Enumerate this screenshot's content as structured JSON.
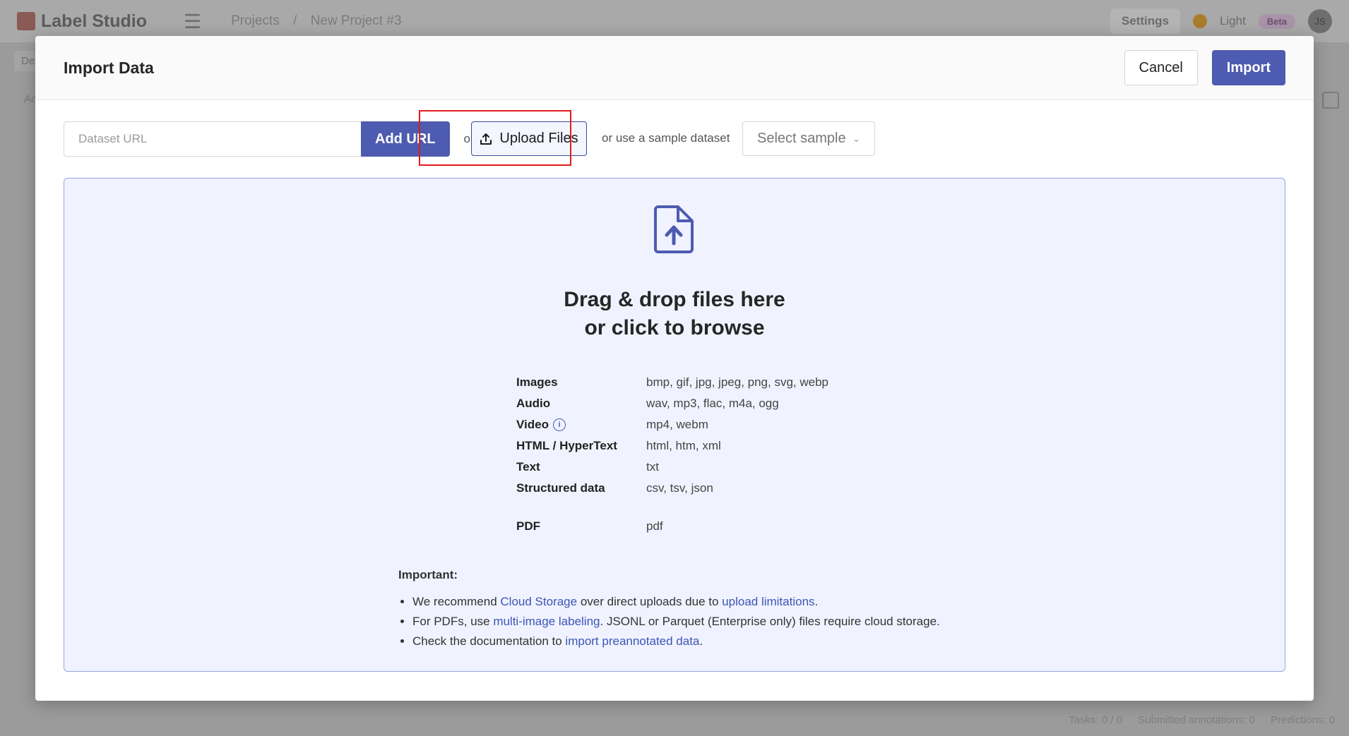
{
  "app": {
    "name": "Label Studio",
    "breadcrumbs": [
      "Projects",
      "/",
      "New Project #3"
    ],
    "settings_label": "Settings",
    "theme_label": "Light",
    "beta_label": "Beta",
    "avatar_initials": "JS",
    "bg_tab_label": "Def",
    "bg_left_text": "Ac"
  },
  "footer": {
    "tasks": "Tasks: 0 / 0",
    "submitted": "Submitted annotations: 0",
    "predictions": "Predictions: 0"
  },
  "modal": {
    "title": "Import Data",
    "cancel_label": "Cancel",
    "import_label": "Import"
  },
  "toolbar": {
    "url_placeholder": "Dataset URL",
    "add_url_label": "Add URL",
    "or_label": "or",
    "upload_label": "Upload Files",
    "sample_text": "or use a sample dataset",
    "select_sample_label": "Select sample"
  },
  "dropzone": {
    "title_line1": "Drag & drop files here",
    "title_line2": "or click to browse",
    "types": [
      {
        "name": "Images",
        "ext": "bmp, gif, jpg, jpeg, png, svg, webp"
      },
      {
        "name": "Audio",
        "ext": "wav, mp3, flac, m4a, ogg"
      },
      {
        "name": "Video",
        "ext": "mp4, webm"
      },
      {
        "name": "HTML / HyperText",
        "ext": "html, htm, xml"
      },
      {
        "name": "Text",
        "ext": "txt"
      },
      {
        "name": "Structured data",
        "ext": "csv, tsv, json"
      },
      {
        "name": "PDF",
        "ext": "pdf"
      }
    ],
    "important_heading": "Important:",
    "notes": {
      "n1_a": "We recommend ",
      "n1_link1": "Cloud Storage",
      "n1_b": " over direct uploads due to ",
      "n1_link2": "upload limitations",
      "n1_c": ".",
      "n2_a": "For PDFs, use ",
      "n2_link": "multi-image labeling",
      "n2_b": ". JSONL or Parquet (Enterprise only) files require cloud storage.",
      "n3_a": "Check the documentation to ",
      "n3_link": "import preannotated data",
      "n3_b": "."
    }
  },
  "colors": {
    "accent": "#4d5bb0",
    "highlight": "#e31b1b",
    "dropzone_bg": "#f0f3ff",
    "link": "#3d55b5"
  }
}
